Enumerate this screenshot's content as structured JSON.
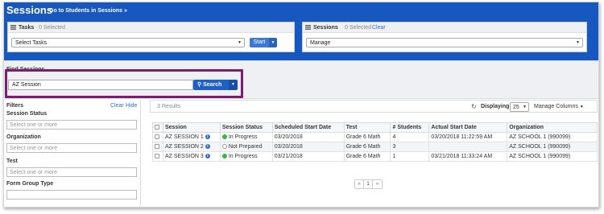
{
  "header": {
    "title": "Sessions",
    "link": "Go to Students in Sessions »"
  },
  "tasks_panel": {
    "title": "Tasks",
    "count": "0 Selected",
    "select_value": "Select Tasks",
    "start_label": "Start",
    "icon": "list-icon"
  },
  "sessions_panel": {
    "title": "Sessions",
    "count": "0 Selected",
    "clear": "Clear",
    "select_value": "Manage",
    "icon": "list-icon"
  },
  "find": {
    "title": "Find Sessions",
    "search_value": "AZ Session",
    "search_label": "Search",
    "highlight_color": "#7b1e73"
  },
  "filters": {
    "title": "Filters",
    "clear": "Clear",
    "hide": "Hide",
    "groups": [
      {
        "label": "Session Status",
        "placeholder": "Select one or more"
      },
      {
        "label": "Organization",
        "placeholder": "Select one or more"
      },
      {
        "label": "Test",
        "placeholder": "Select one or more"
      },
      {
        "label": "Form Group Type",
        "placeholder": ""
      }
    ]
  },
  "results": {
    "count": "3 Results",
    "displaying_label": "Displaying",
    "displaying_value": "25",
    "manage_columns": "Manage Columns",
    "columns": [
      "Session",
      "Session Status",
      "Scheduled Start Date",
      "Test",
      "# Students",
      "Actual Start Date",
      "Organization"
    ],
    "rows": [
      {
        "session": "AZ SESSION 1",
        "status": "In Progress",
        "status_kind": "green",
        "scheduled": "03/20/2018",
        "test": "Grade 6 Math",
        "students": "4",
        "actual": "03/20/2018 11:22:59 AM",
        "org": "AZ SCHOOL 1 (990099)"
      },
      {
        "session": "AZ SESSION 2",
        "status": "Not Prepared",
        "status_kind": "empty",
        "scheduled": "03/20/2018",
        "test": "Grade 6 Math",
        "students": "3",
        "actual": "",
        "org": "AZ SCHOOL 1 (990099)"
      },
      {
        "session": "AZ SESSION 3",
        "status": "In Progress",
        "status_kind": "green",
        "scheduled": "03/21/2018",
        "test": "Grade 6 Math",
        "students": "1",
        "actual": "03/21/2018 11:33:24 AM",
        "org": "AZ SCHOOL 1 (990099)"
      }
    ],
    "pager": {
      "prev": "«",
      "page": "1",
      "next": "»"
    }
  },
  "colors": {
    "brand_blue": "#1757c0",
    "button_blue": "#1e5fc8",
    "status_green": "#3eb04b"
  }
}
